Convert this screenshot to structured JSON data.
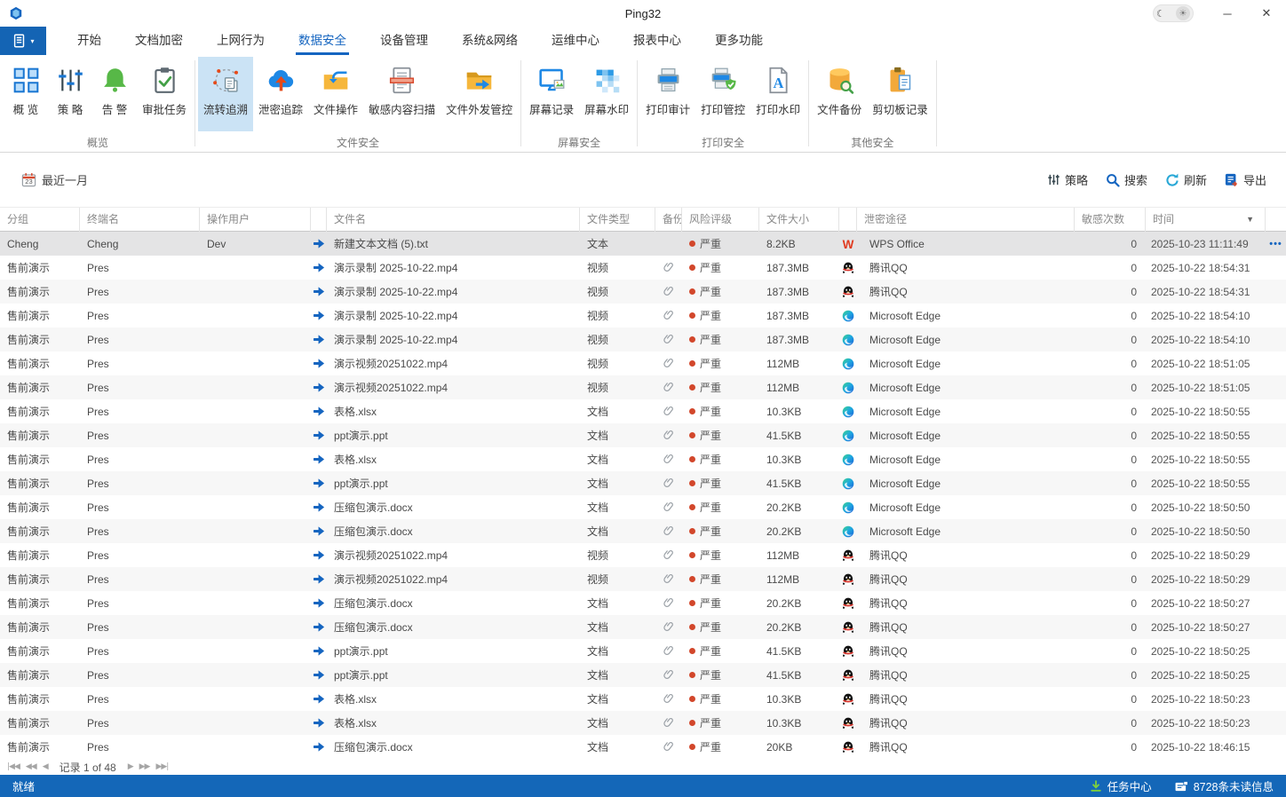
{
  "window": {
    "title": "Ping32"
  },
  "colors": {
    "accent": "#1565C0",
    "statusbar": "#1467B8",
    "risk_dot": "#D2472B",
    "ribbon_highlight": "#CBE3F5",
    "selected_row": "#E4E4E5"
  },
  "menu": {
    "active": "数据安全",
    "items": [
      {
        "key": "home",
        "label": "开始"
      },
      {
        "key": "doc-encrypt",
        "label": "文档加密"
      },
      {
        "key": "web-behavior",
        "label": "上网行为"
      },
      {
        "key": "data-security",
        "label": "数据安全",
        "active": true
      },
      {
        "key": "device-mgmt",
        "label": "设备管理"
      },
      {
        "key": "system-network",
        "label": "系统&网络"
      },
      {
        "key": "ops-center",
        "label": "运维中心"
      },
      {
        "key": "report-center",
        "label": "报表中心"
      },
      {
        "key": "more-features",
        "label": "更多功能"
      }
    ]
  },
  "ribbon": {
    "groups": [
      {
        "label": "概览",
        "items": [
          {
            "key": "overview",
            "label": "概 览",
            "icon": "grid"
          },
          {
            "key": "policy",
            "label": "策 略",
            "icon": "sliders"
          },
          {
            "key": "alert",
            "label": "告 警",
            "icon": "bell"
          },
          {
            "key": "approval-tasks",
            "label": "审批任务",
            "icon": "clipboard-check"
          }
        ]
      },
      {
        "label": "文件安全",
        "items": [
          {
            "key": "flow-trace",
            "label": "流转追溯",
            "icon": "trace",
            "active": true
          },
          {
            "key": "leak-trace",
            "label": "泄密追踪",
            "icon": "cloud-up"
          },
          {
            "key": "file-operations",
            "label": "文件操作",
            "icon": "folder-return"
          },
          {
            "key": "sensitive-scan",
            "label": "敏感内容扫描",
            "icon": "doc-scan"
          },
          {
            "key": "file-outgoing-control",
            "label": "文件外发管控",
            "icon": "folder-out"
          }
        ]
      },
      {
        "label": "屏幕安全",
        "items": [
          {
            "key": "screen-record",
            "label": "屏幕记录",
            "icon": "monitor"
          },
          {
            "key": "screen-watermark",
            "label": "屏幕水印",
            "icon": "checker"
          }
        ]
      },
      {
        "label": "打印安全",
        "items": [
          {
            "key": "print-audit",
            "label": "打印审计",
            "icon": "printer"
          },
          {
            "key": "print-control",
            "label": "打印管控",
            "icon": "printer-shield"
          },
          {
            "key": "print-watermark",
            "label": "打印水印",
            "icon": "doc-a"
          }
        ]
      },
      {
        "label": "其他安全",
        "items": [
          {
            "key": "file-backup",
            "label": "文件备份",
            "icon": "db-search"
          },
          {
            "key": "clipboard-record",
            "label": "剪切板记录",
            "icon": "clipboard-doc"
          }
        ]
      }
    ]
  },
  "filterbar": {
    "date_label": "最近一月",
    "actions": [
      {
        "key": "policy",
        "label": "策略",
        "icon": "sliders-sm"
      },
      {
        "key": "search",
        "label": "搜索",
        "icon": "search"
      },
      {
        "key": "refresh",
        "label": "刷新",
        "icon": "refresh"
      },
      {
        "key": "export",
        "label": "导出",
        "icon": "export"
      }
    ]
  },
  "table": {
    "headers": [
      {
        "key": "group",
        "label": "分组"
      },
      {
        "key": "terminal",
        "label": "终端名"
      },
      {
        "key": "operator",
        "label": "操作用户"
      },
      {
        "key": "file-icon",
        "label": ""
      },
      {
        "key": "filename",
        "label": "文件名"
      },
      {
        "key": "filetype",
        "label": "文件类型"
      },
      {
        "key": "backup",
        "label": "备份"
      },
      {
        "key": "risk",
        "label": "风险评级"
      },
      {
        "key": "filesize",
        "label": "文件大小"
      },
      {
        "key": "app-icon",
        "label": ""
      },
      {
        "key": "channel",
        "label": "泄密途径"
      },
      {
        "key": "sensitive-count",
        "label": "敏感次数"
      },
      {
        "key": "time",
        "label": "时间",
        "filter": true
      },
      {
        "key": "actions",
        "label": ""
      }
    ],
    "rows": [
      {
        "group": "Cheng",
        "terminal": "Cheng",
        "user": "Dev",
        "file": "新建文本文档 (5).txt",
        "type": "文本",
        "backup": false,
        "risk": "严重",
        "size": "8.2KB",
        "app_icon": "wps",
        "app": "WPS Office",
        "count": "0",
        "time": "2025-10-23 11:11:49",
        "selected": true,
        "more": true
      },
      {
        "group": "售前演示",
        "terminal": "Pres",
        "user": "",
        "file": "演示录制 2025-10-22.mp4",
        "type": "视频",
        "backup": true,
        "risk": "严重",
        "size": "187.3MB",
        "app_icon": "qq",
        "app": "腾讯QQ",
        "count": "0",
        "time": "2025-10-22 18:54:31"
      },
      {
        "group": "售前演示",
        "terminal": "Pres",
        "user": "",
        "file": "演示录制 2025-10-22.mp4",
        "type": "视频",
        "backup": true,
        "risk": "严重",
        "size": "187.3MB",
        "app_icon": "qq",
        "app": "腾讯QQ",
        "count": "0",
        "time": "2025-10-22 18:54:31"
      },
      {
        "group": "售前演示",
        "terminal": "Pres",
        "user": "",
        "file": "演示录制 2025-10-22.mp4",
        "type": "视频",
        "backup": true,
        "risk": "严重",
        "size": "187.3MB",
        "app_icon": "edge",
        "app": "Microsoft Edge",
        "count": "0",
        "time": "2025-10-22 18:54:10"
      },
      {
        "group": "售前演示",
        "terminal": "Pres",
        "user": "",
        "file": "演示录制 2025-10-22.mp4",
        "type": "视频",
        "backup": true,
        "risk": "严重",
        "size": "187.3MB",
        "app_icon": "edge",
        "app": "Microsoft Edge",
        "count": "0",
        "time": "2025-10-22 18:54:10"
      },
      {
        "group": "售前演示",
        "terminal": "Pres",
        "user": "",
        "file": "演示视频20251022.mp4",
        "type": "视频",
        "backup": true,
        "risk": "严重",
        "size": "112MB",
        "app_icon": "edge",
        "app": "Microsoft Edge",
        "count": "0",
        "time": "2025-10-22 18:51:05"
      },
      {
        "group": "售前演示",
        "terminal": "Pres",
        "user": "",
        "file": "演示视频20251022.mp4",
        "type": "视频",
        "backup": true,
        "risk": "严重",
        "size": "112MB",
        "app_icon": "edge",
        "app": "Microsoft Edge",
        "count": "0",
        "time": "2025-10-22 18:51:05"
      },
      {
        "group": "售前演示",
        "terminal": "Pres",
        "user": "",
        "file": "表格.xlsx",
        "type": "文档",
        "backup": true,
        "risk": "严重",
        "size": "10.3KB",
        "app_icon": "edge",
        "app": "Microsoft Edge",
        "count": "0",
        "time": "2025-10-22 18:50:55"
      },
      {
        "group": "售前演示",
        "terminal": "Pres",
        "user": "",
        "file": "ppt演示.ppt",
        "type": "文档",
        "backup": true,
        "risk": "严重",
        "size": "41.5KB",
        "app_icon": "edge",
        "app": "Microsoft Edge",
        "count": "0",
        "time": "2025-10-22 18:50:55"
      },
      {
        "group": "售前演示",
        "terminal": "Pres",
        "user": "",
        "file": "表格.xlsx",
        "type": "文档",
        "backup": true,
        "risk": "严重",
        "size": "10.3KB",
        "app_icon": "edge",
        "app": "Microsoft Edge",
        "count": "0",
        "time": "2025-10-22 18:50:55"
      },
      {
        "group": "售前演示",
        "terminal": "Pres",
        "user": "",
        "file": "ppt演示.ppt",
        "type": "文档",
        "backup": true,
        "risk": "严重",
        "size": "41.5KB",
        "app_icon": "edge",
        "app": "Microsoft Edge",
        "count": "0",
        "time": "2025-10-22 18:50:55"
      },
      {
        "group": "售前演示",
        "terminal": "Pres",
        "user": "",
        "file": "压缩包演示.docx",
        "type": "文档",
        "backup": true,
        "risk": "严重",
        "size": "20.2KB",
        "app_icon": "edge",
        "app": "Microsoft Edge",
        "count": "0",
        "time": "2025-10-22 18:50:50"
      },
      {
        "group": "售前演示",
        "terminal": "Pres",
        "user": "",
        "file": "压缩包演示.docx",
        "type": "文档",
        "backup": true,
        "risk": "严重",
        "size": "20.2KB",
        "app_icon": "edge",
        "app": "Microsoft Edge",
        "count": "0",
        "time": "2025-10-22 18:50:50"
      },
      {
        "group": "售前演示",
        "terminal": "Pres",
        "user": "",
        "file": "演示视频20251022.mp4",
        "type": "视频",
        "backup": true,
        "risk": "严重",
        "size": "112MB",
        "app_icon": "qq",
        "app": "腾讯QQ",
        "count": "0",
        "time": "2025-10-22 18:50:29"
      },
      {
        "group": "售前演示",
        "terminal": "Pres",
        "user": "",
        "file": "演示视频20251022.mp4",
        "type": "视频",
        "backup": true,
        "risk": "严重",
        "size": "112MB",
        "app_icon": "qq",
        "app": "腾讯QQ",
        "count": "0",
        "time": "2025-10-22 18:50:29"
      },
      {
        "group": "售前演示",
        "terminal": "Pres",
        "user": "",
        "file": "压缩包演示.docx",
        "type": "文档",
        "backup": true,
        "risk": "严重",
        "size": "20.2KB",
        "app_icon": "qq",
        "app": "腾讯QQ",
        "count": "0",
        "time": "2025-10-22 18:50:27"
      },
      {
        "group": "售前演示",
        "terminal": "Pres",
        "user": "",
        "file": "压缩包演示.docx",
        "type": "文档",
        "backup": true,
        "risk": "严重",
        "size": "20.2KB",
        "app_icon": "qq",
        "app": "腾讯QQ",
        "count": "0",
        "time": "2025-10-22 18:50:27"
      },
      {
        "group": "售前演示",
        "terminal": "Pres",
        "user": "",
        "file": "ppt演示.ppt",
        "type": "文档",
        "backup": true,
        "risk": "严重",
        "size": "41.5KB",
        "app_icon": "qq",
        "app": "腾讯QQ",
        "count": "0",
        "time": "2025-10-22 18:50:25"
      },
      {
        "group": "售前演示",
        "terminal": "Pres",
        "user": "",
        "file": "ppt演示.ppt",
        "type": "文档",
        "backup": true,
        "risk": "严重",
        "size": "41.5KB",
        "app_icon": "qq",
        "app": "腾讯QQ",
        "count": "0",
        "time": "2025-10-22 18:50:25"
      },
      {
        "group": "售前演示",
        "terminal": "Pres",
        "user": "",
        "file": "表格.xlsx",
        "type": "文档",
        "backup": true,
        "risk": "严重",
        "size": "10.3KB",
        "app_icon": "qq",
        "app": "腾讯QQ",
        "count": "0",
        "time": "2025-10-22 18:50:23"
      },
      {
        "group": "售前演示",
        "terminal": "Pres",
        "user": "",
        "file": "表格.xlsx",
        "type": "文档",
        "backup": true,
        "risk": "严重",
        "size": "10.3KB",
        "app_icon": "qq",
        "app": "腾讯QQ",
        "count": "0",
        "time": "2025-10-22 18:50:23"
      },
      {
        "group": "售前演示",
        "terminal": "Pres",
        "user": "",
        "file": "压缩包演示.docx",
        "type": "文档",
        "backup": true,
        "risk": "严重",
        "size": "20KB",
        "app_icon": "qq",
        "app": "腾讯QQ",
        "count": "0",
        "time": "2025-10-22 18:46:15"
      }
    ]
  },
  "pagination": {
    "record_label": "记录 1 of 48"
  },
  "statusbar": {
    "ready": "就绪",
    "task_center": "任务中心",
    "messages": "8728条未读信息"
  }
}
